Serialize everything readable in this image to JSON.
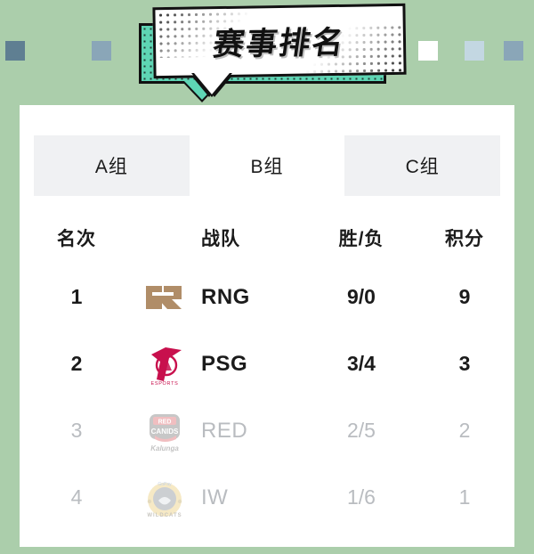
{
  "theme": {
    "background_green": "#abceab",
    "card_white": "#ffffff",
    "tabstrip_gray": "#f0f1f3",
    "banner_teal": "#5ed5b4",
    "ink_black": "#111111",
    "dim_gray": "#b9bcc0"
  },
  "decor": {
    "left_squares": [
      "#5f7f92",
      "#8aa6b8",
      "#c3d7e2",
      "#ffffff"
    ],
    "right_squares": [
      "#ffffff",
      "#c3d7e2",
      "#8aa6b8",
      "#5f7f92"
    ]
  },
  "header": {
    "title": "赛事排名"
  },
  "tabs": {
    "items": [
      {
        "label": "A组",
        "active": false
      },
      {
        "label": "B组",
        "active": true
      },
      {
        "label": "C组",
        "active": false
      }
    ]
  },
  "table": {
    "columns": {
      "rank": "名次",
      "team": "战队",
      "record": "胜/负",
      "points": "积分"
    },
    "rows": [
      {
        "rank": "1",
        "logo": "rng-logo",
        "logo_color": "#b08d68",
        "team": "RNG",
        "record": "9/0",
        "points": "9",
        "dimmed": false
      },
      {
        "rank": "2",
        "logo": "psg-esports-logo",
        "logo_color": "#c8104d",
        "team": "PSG",
        "record": "3/4",
        "points": "3",
        "dimmed": false
      },
      {
        "rank": "3",
        "logo": "red-canids-kalunga-logo",
        "logo_color": "#cf2b33",
        "team": "RED",
        "record": "2/5",
        "points": "2",
        "dimmed": true
      },
      {
        "rank": "4",
        "logo": "wildcats-logo",
        "logo_color": "#e2b842",
        "team": "IW",
        "record": "1/6",
        "points": "1",
        "dimmed": true
      }
    ]
  }
}
